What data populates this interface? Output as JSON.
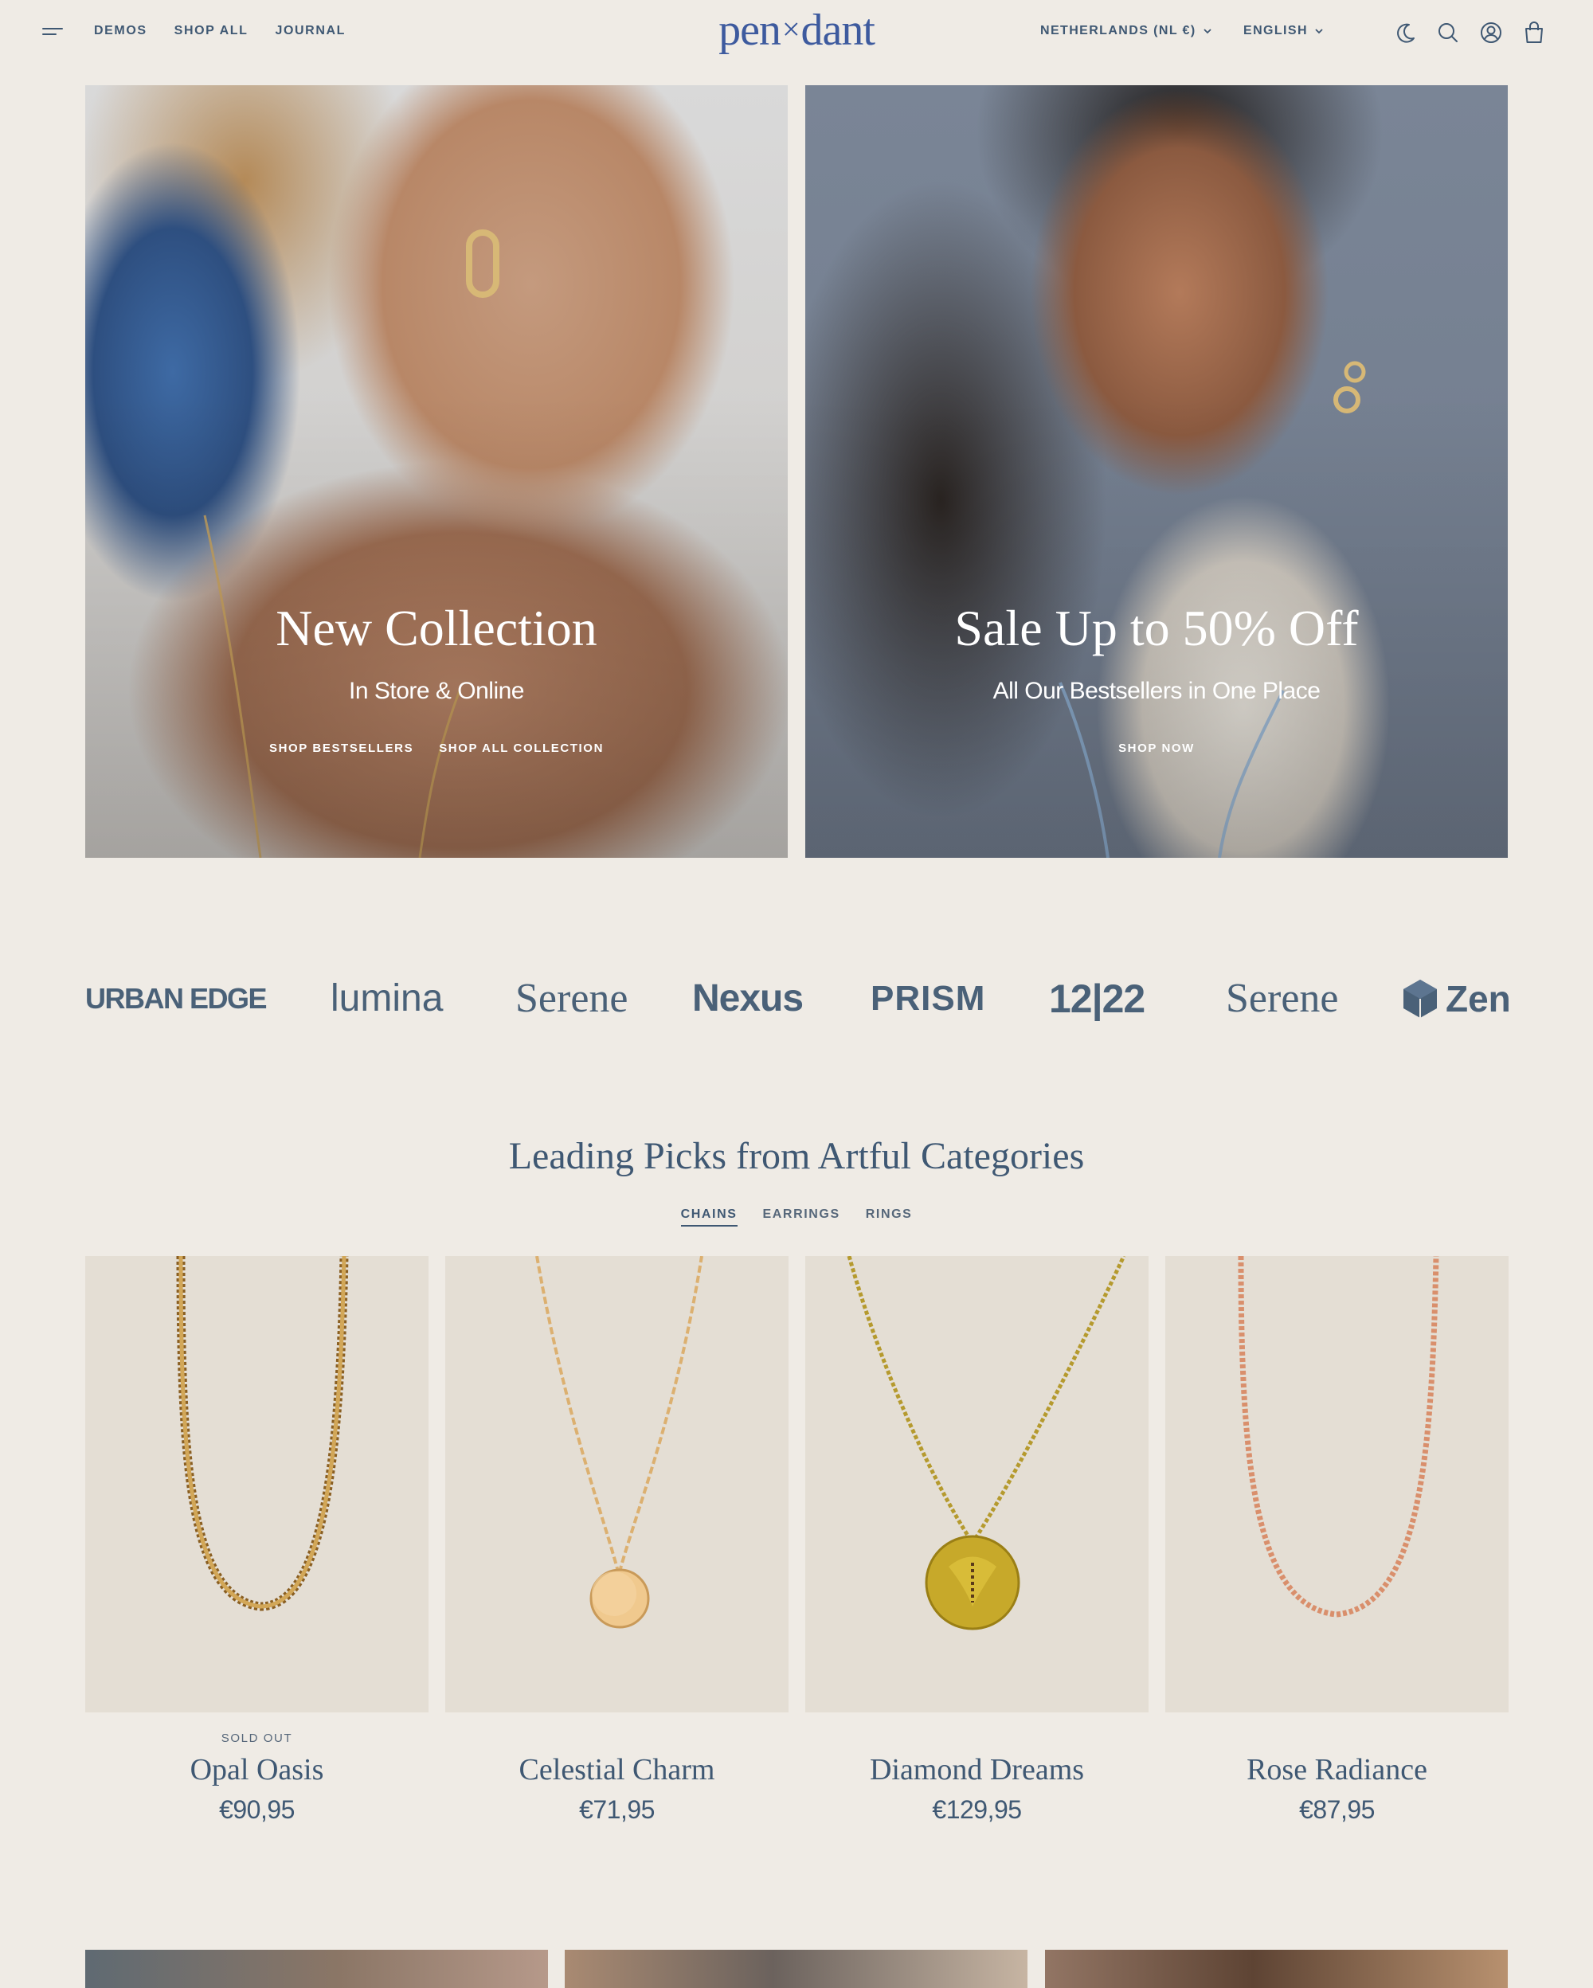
{
  "header": {
    "logo_left": "pen",
    "logo_mid": "×",
    "logo_right": "dant",
    "nav": [
      {
        "label": "DEMOS"
      },
      {
        "label": "SHOP ALL"
      },
      {
        "label": "JOURNAL"
      }
    ],
    "country": "NETHERLANDS (NL €)",
    "language": "ENGLISH",
    "icons": [
      "menu-icon",
      "moon-icon",
      "search-icon",
      "account-icon",
      "cart-icon"
    ]
  },
  "hero": [
    {
      "title": "New Collection",
      "subtitle": "In Store & Online",
      "links": [
        "SHOP BESTSELLERS",
        "SHOP ALL COLLECTION"
      ]
    },
    {
      "title": "Sale Up to 50% Off",
      "subtitle": "All Our Bestsellers in One Place",
      "links": [
        "SHOP NOW"
      ]
    }
  ],
  "brands": [
    "URBAN EDGE",
    "lumina",
    "Serene",
    "Nexus",
    "PRISM",
    "12|22",
    "Serene",
    "Zen"
  ],
  "picks": {
    "title": "Leading Picks from Artful Categories",
    "tabs": [
      "CHAINS",
      "EARRINGS",
      "RINGS"
    ],
    "active_tab": "CHAINS",
    "products": [
      {
        "name": "Opal Oasis",
        "price": "€90,95",
        "badge": "SOLD OUT"
      },
      {
        "name": "Celestial Charm",
        "price": "€71,95",
        "badge": ""
      },
      {
        "name": "Diamond Dreams",
        "price": "€129,95",
        "badge": ""
      },
      {
        "name": "Rose Radiance",
        "price": "€87,95",
        "badge": ""
      }
    ]
  },
  "colors": {
    "background": "#efebe5",
    "text": "#3f5873",
    "logo": "#3d5a9e",
    "product_bg": "#e4ded4"
  }
}
